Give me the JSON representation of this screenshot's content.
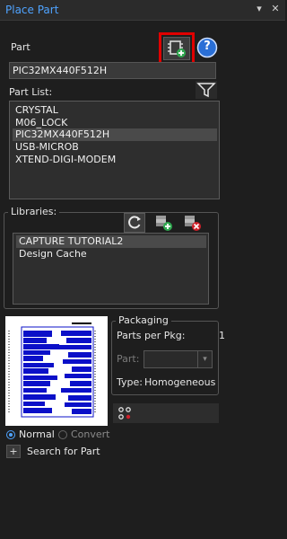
{
  "title": "Place Part",
  "titlebar": {
    "pin_glyph": "▾",
    "close_glyph": "✕"
  },
  "part": {
    "label": "Part",
    "value": "PIC32MX440F512H",
    "add_part_icon": "chip-add-icon",
    "help_icon": "help-icon",
    "help_glyph": "?"
  },
  "part_list": {
    "label": "Part List:",
    "filter_icon": "filter-icon",
    "items": [
      "CRYSTAL",
      "M06_LOCK",
      "PIC32MX440F512H",
      "USB-MICROB",
      "XTEND-DIGI-MODEM"
    ],
    "selected_index": 2
  },
  "libraries": {
    "label": "Libraries:",
    "refresh_icon": "refresh-icon",
    "add_library_icon": "add-library-icon",
    "remove_library_icon": "remove-library-icon",
    "items": [
      "CAPTURE TUTORIAL2",
      "Design Cache"
    ],
    "selected_index": 0
  },
  "packaging": {
    "title": "Packaging",
    "parts_per_pkg_label": "Parts per Pkg:",
    "parts_per_pkg_value": "1",
    "part_label": "Part:",
    "part_value": "",
    "type_label": "Type:",
    "type_value": "Homogeneous"
  },
  "graphic": {
    "options": [
      "Normal",
      "Convert"
    ],
    "selected": "Normal"
  },
  "search": {
    "expand_glyph": "+",
    "label": "Search for Part"
  },
  "colors": {
    "accent": "#4fa3ff",
    "highlight": "#e00000",
    "add": "#2fa84f",
    "remove": "#d0202a",
    "preview_blue": "#0b10c8"
  }
}
